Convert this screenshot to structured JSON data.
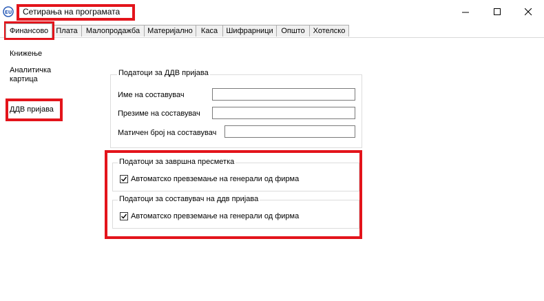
{
  "window": {
    "title": "Сетирања на програмата",
    "controls": {
      "minimize": "—",
      "maximize": "☐",
      "close": "✕"
    }
  },
  "tabs": [
    {
      "label": "Финансово",
      "active": true
    },
    {
      "label": "Плата"
    },
    {
      "label": "Малопродажба"
    },
    {
      "label": "Материјално"
    },
    {
      "label": "Каса"
    },
    {
      "label": "Шифрарници"
    },
    {
      "label": "Општо"
    },
    {
      "label": "Хотелско"
    }
  ],
  "sidebar": {
    "items": [
      {
        "label": "Книжење"
      },
      {
        "label": "Аналитичка картица"
      },
      {
        "label": "ДДВ пријава"
      }
    ]
  },
  "vat_group": {
    "legend": "Податоци за ДДВ пријава",
    "fields": [
      {
        "label": "Име на составувач",
        "value": ""
      },
      {
        "label": "Презиме на составувач",
        "value": ""
      },
      {
        "label": "Матичен број на составувач",
        "value": ""
      }
    ]
  },
  "final_group": {
    "legend": "Податоци за завршна пресметка",
    "checkbox_label": "Автоматско превземање на генерали од фирма",
    "checked": true
  },
  "compiler_group": {
    "legend": "Податоци за составувач на ддв пријава",
    "checkbox_label": "Автоматско превземање на генерали од фирма",
    "checked": true
  },
  "colors": {
    "highlight": "#e3141b",
    "tab_bg": "#f0f0f0",
    "group_border": "#dcdcdc"
  },
  "icons": {
    "app": "app-logo-icon",
    "minimize": "minimize-icon",
    "maximize": "maximize-icon",
    "close": "close-icon",
    "check": "checkmark-icon"
  }
}
